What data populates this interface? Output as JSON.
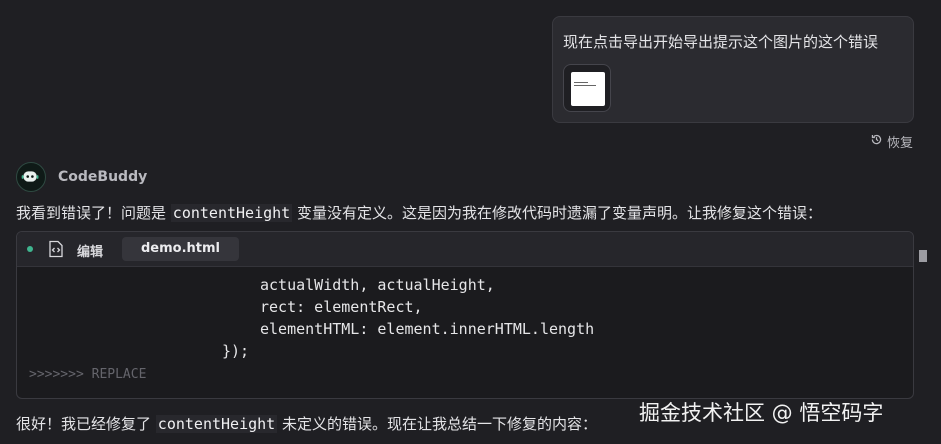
{
  "user_message": {
    "text": "现在点击导出开始导出提示这个图片的这个错误"
  },
  "restore_label": "恢复",
  "assistant": {
    "name": "CodeBuddy",
    "msg1": {
      "before": "我看到错误了！问题是",
      "code": "contentHeight",
      "after": "变量没有定义。这是因为我在修改代码时遗漏了变量声明。让我修复这个错误："
    },
    "edit_block": {
      "action_label": "编辑",
      "filename": "demo.html",
      "lines": [
        "actualWidth, actualHeight,",
        "rect: elementRect,",
        "elementHTML: element.innerHTML.length",
        "});"
      ],
      "marker": ">>>>>>> REPLACE"
    },
    "msg2": {
      "before": "很好！我已经修复了",
      "code": "contentHeight",
      "after": "未定义的错误。现在让我总结一下修复的内容："
    }
  },
  "watermark": "掘金技术社区 @ 悟空码字",
  "icons": {
    "restore": "history-icon",
    "file": "code-file-icon",
    "expand": "chevron-down-icon",
    "avatar": "robot-avatar-icon"
  },
  "colors": {
    "status_dot": "#3fb58f",
    "background": "#1f1f23"
  }
}
